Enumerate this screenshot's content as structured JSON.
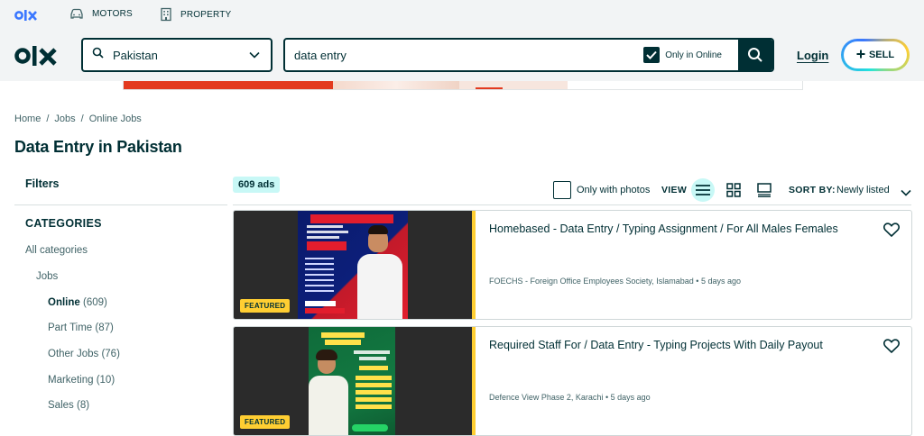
{
  "topbar": {
    "categories": [
      {
        "label": "MOTORS",
        "icon": "car-icon"
      },
      {
        "label": "PROPERTY",
        "icon": "building-icon"
      }
    ]
  },
  "header": {
    "location": {
      "value": "Pakistan",
      "icon": "search-icon"
    },
    "search": {
      "value": "data entry",
      "only_in_label": "Only in Online",
      "only_in_checked": true
    },
    "login_label": "Login",
    "sell_label": "SELL"
  },
  "breadcrumb": [
    "Home",
    "Jobs",
    "Online Jobs"
  ],
  "page_title": "Data Entry in Pakistan",
  "sidebar": {
    "filters_label": "Filters",
    "categories_label": "CATEGORIES",
    "all_categories": "All categories",
    "jobs": "Jobs",
    "items": [
      {
        "label": "Online",
        "count": "(609)",
        "active": true
      },
      {
        "label": "Part Time",
        "count": "(87)",
        "active": false
      },
      {
        "label": "Other Jobs",
        "count": "(76)",
        "active": false
      },
      {
        "label": "Marketing",
        "count": "(10)",
        "active": false
      },
      {
        "label": "Sales",
        "count": "(8)",
        "active": false
      }
    ]
  },
  "listing_controls": {
    "ad_count": "609 ads",
    "only_photos_label": "Only with photos",
    "view_label": "VIEW",
    "sort_label": "SORT BY:",
    "sort_value": "Newly listed"
  },
  "listings": [
    {
      "title": "Homebased - Data Entry / Typing Assignment / For All Males Females",
      "location": "FOECHS - Foreign Office Employees Society, Islamabad",
      "time": "5 days ago",
      "badge": "FEATURED"
    },
    {
      "title": "Required Staff For / Data Entry - Typing Projects With Daily Payout",
      "location": "Defence View Phase 2, Karachi",
      "time": "5 days ago",
      "badge": "FEATURED"
    }
  ],
  "colors": {
    "brand": "#002f34",
    "accent": "#23e5db",
    "featured": "#ffce32",
    "count_badge": "#c8f8f6"
  }
}
